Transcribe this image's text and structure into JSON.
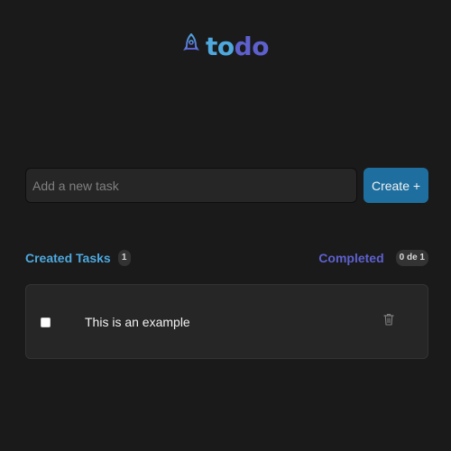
{
  "header": {
    "logo_icon": "rocket-icon",
    "logo_part1": "to",
    "logo_part2": "do",
    "colors": {
      "to": "#4ea8de",
      "do": "#5e60ce"
    }
  },
  "form": {
    "input_value": "",
    "input_placeholder": "Add a new task",
    "create_label": "Create +"
  },
  "counters": {
    "created_label": "Created Tasks",
    "created_count": "1",
    "completed_label": "Completed",
    "completed_count": "0 de 1"
  },
  "tasks": [
    {
      "text": "This is an example",
      "checked": false,
      "delete_icon": "trash-icon"
    }
  ],
  "colors": {
    "background": "#1a1a1a",
    "surface": "#262626",
    "accent_blue": "#4ea8de",
    "accent_purple": "#5e60ce",
    "button": "#1e6f9f"
  }
}
